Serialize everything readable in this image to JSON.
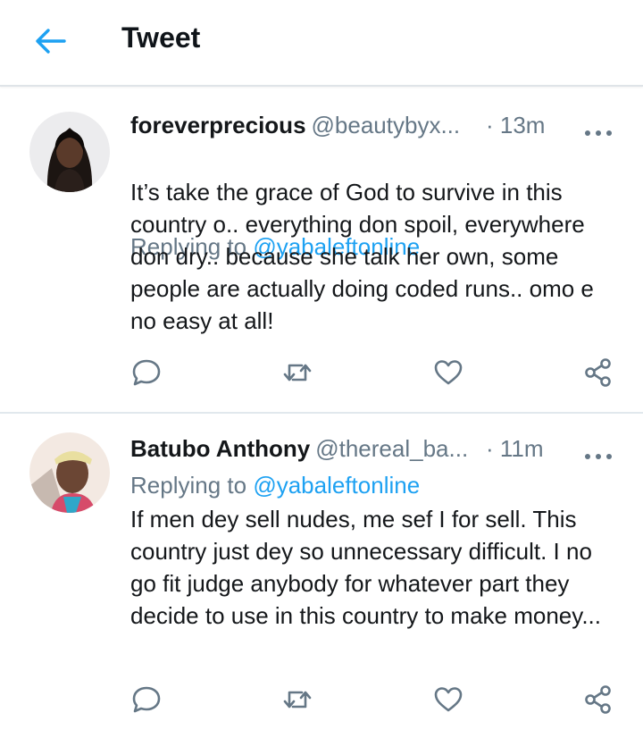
{
  "header": {
    "title": "Tweet",
    "back_icon": "arrow-left-icon",
    "accent": "#1da1f2"
  },
  "tweets": [
    {
      "name": "foreverprecious",
      "handle": "@beautybyx...",
      "time": "· 13m",
      "replying_prefix": "Replying to ",
      "replying_to": "@yabaleftonline",
      "text": "It’s take the grace of God to survive in this country o.. everything don spoil, everywhere don dry.. because she talk her own, some people are actually doing coded runs.. omo e no easy at all!"
    },
    {
      "name": "Batubo Anthony",
      "handle": "@thereal_ba...",
      "time": "· 11m",
      "replying_prefix": "Replying to ",
      "replying_to": "@yabaleftonline",
      "text": "If men dey sell nudes, me sef I for sell. This country just dey so unnecessary difficult. I no go fit judge anybody for whatever part they decide to use in this country to make money..."
    }
  ],
  "action_icons": [
    "reply-icon",
    "retweet-icon",
    "like-icon",
    "share-icon"
  ],
  "colors": {
    "icon_gray": "#657786",
    "text": "#14171a",
    "link": "#1da1f2",
    "divider": "#e1e8ed"
  }
}
